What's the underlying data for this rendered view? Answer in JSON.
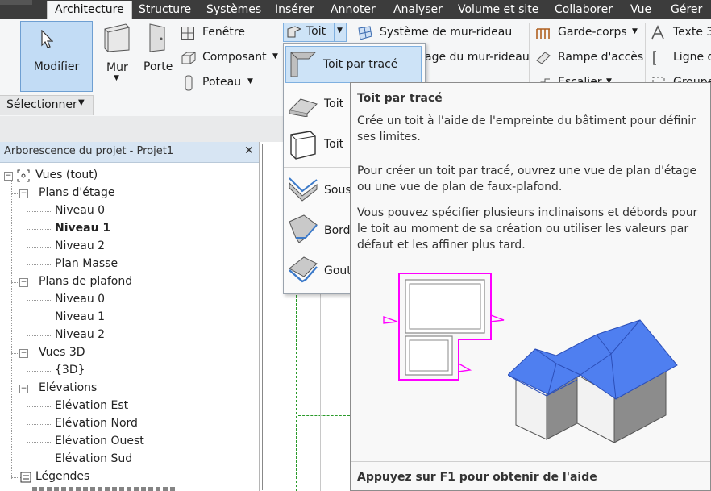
{
  "ribbon": {
    "tabs": [
      "Architecture",
      "Structure",
      "Systèmes",
      "Insérer",
      "Annoter",
      "Analyser",
      "Volume et site",
      "Collaborer",
      "Vue",
      "Gérer"
    ],
    "modifier_label": "Modifier",
    "panel_label": "Sélectionner",
    "mur_label": "Mur",
    "porte_label": "Porte",
    "fenetre_label": "Fenêtre",
    "composant_label": "Composant",
    "poteau_label": "Poteau",
    "toit_label": "Toit",
    "systeme_mur_rideau": "Système de mur-rideau",
    "quadrillage_mur_rideau": "age du mur-rideau",
    "garde_corps": "Garde-corps",
    "rampe_acces": "Rampe d'accès",
    "escalier": "Escalier",
    "texte3d": "Texte 3",
    "ligne": "Ligne d",
    "groupe": "Groupe"
  },
  "dropdown": {
    "items": [
      "Toit par tracé",
      "Toit",
      "Toit",
      "Sous",
      "Bord",
      "Gout"
    ]
  },
  "browser": {
    "title": "Arborescence du projet - Projet1",
    "close": "✕",
    "root": "Vues (tout)",
    "plans_etage": "Plans d'étage",
    "plans_etage_items": [
      "Niveau 0",
      "Niveau 1",
      "Niveau 2",
      "Plan Masse"
    ],
    "plans_plafond": "Plans de plafond",
    "plans_plafond_items": [
      "Niveau 0",
      "Niveau 1",
      "Niveau 2"
    ],
    "vues3d": "Vues 3D",
    "vues3d_items": [
      "{3D}"
    ],
    "elevations": "Elévations",
    "elevations_items": [
      "Elévation Est",
      "Elévation Nord",
      "Elévation Ouest",
      "Elévation Sud"
    ],
    "legendes": "Légendes"
  },
  "tooltip": {
    "title": "Toit par tracé",
    "para1": "Crée un toit à l'aide de l'empreinte du bâtiment pour définir ses limites.",
    "para2": "Pour créer un toit par tracé, ouvrez une vue de plan d'étage ou une vue de plan de faux-plafond.",
    "para3": "Vous pouvez spécifier plusieurs inclinaisons et débords pour le toit au moment de sa création ou utiliser les valeurs par défaut et les affiner plus tard.",
    "footer": "Appuyez sur F1 pour obtenir de l'aide"
  },
  "colors": {
    "accent": "#c2dcf5",
    "roof_blue": "#4f7ff0",
    "sketch_magenta": "#ff00ff"
  }
}
